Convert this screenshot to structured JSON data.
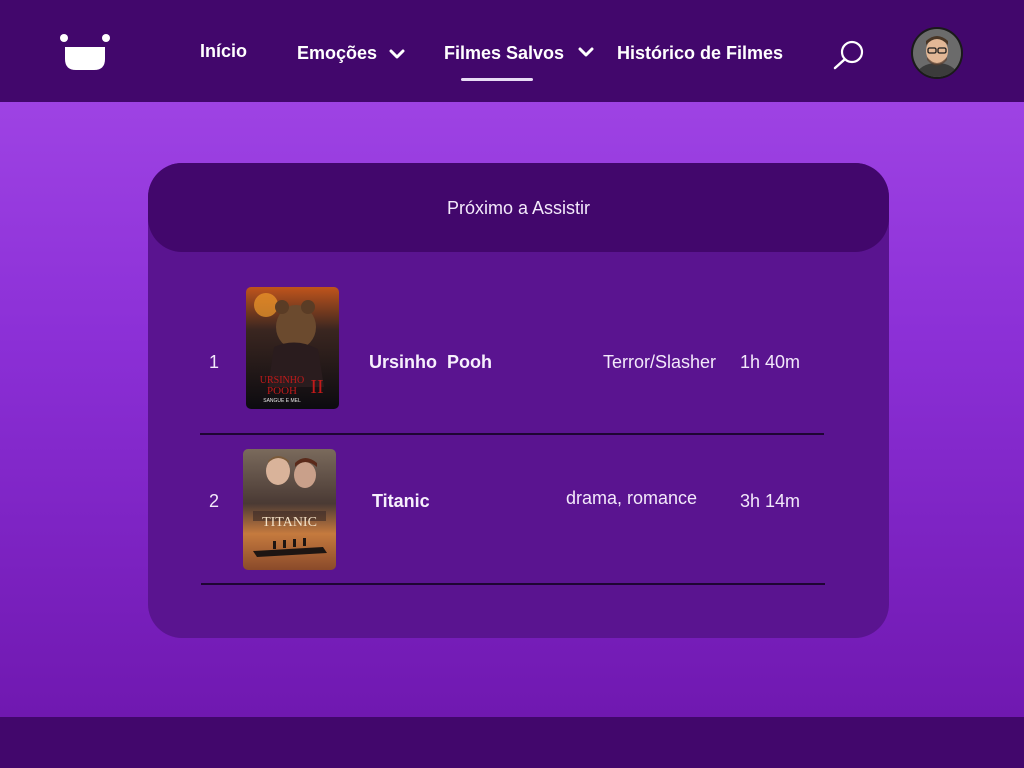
{
  "nav": {
    "home": "Início",
    "emotions": "Emoções",
    "saved": "Filmes Salvos",
    "history": "Histórico de Filmes"
  },
  "icons": {
    "logo": "smiley-logo",
    "emotions_dropdown": "chevron-down-icon",
    "saved_dropdown": "chevron-down-icon",
    "search": "search-icon",
    "avatar": "user-avatar"
  },
  "panel": {
    "title": "Próximo a Assistir",
    "movies": [
      {
        "rank": "1",
        "title": "Ursinho  Pooh",
        "genre": "Terror/Slasher",
        "duration": "1h 40m",
        "poster_text": [
          "URSINHO",
          "POOH",
          "II",
          "SANGUE E MEL"
        ]
      },
      {
        "rank": "2",
        "title": "Titanic",
        "genre": "drama, romance",
        "duration": "3h 14m",
        "poster_text": [
          "TITANIC"
        ]
      }
    ]
  },
  "colors": {
    "topbar": "#42076c",
    "panel": "#5a1490",
    "panel_header": "#42076c",
    "background_top": "#a64be9",
    "background_bottom": "#6c15ab"
  }
}
